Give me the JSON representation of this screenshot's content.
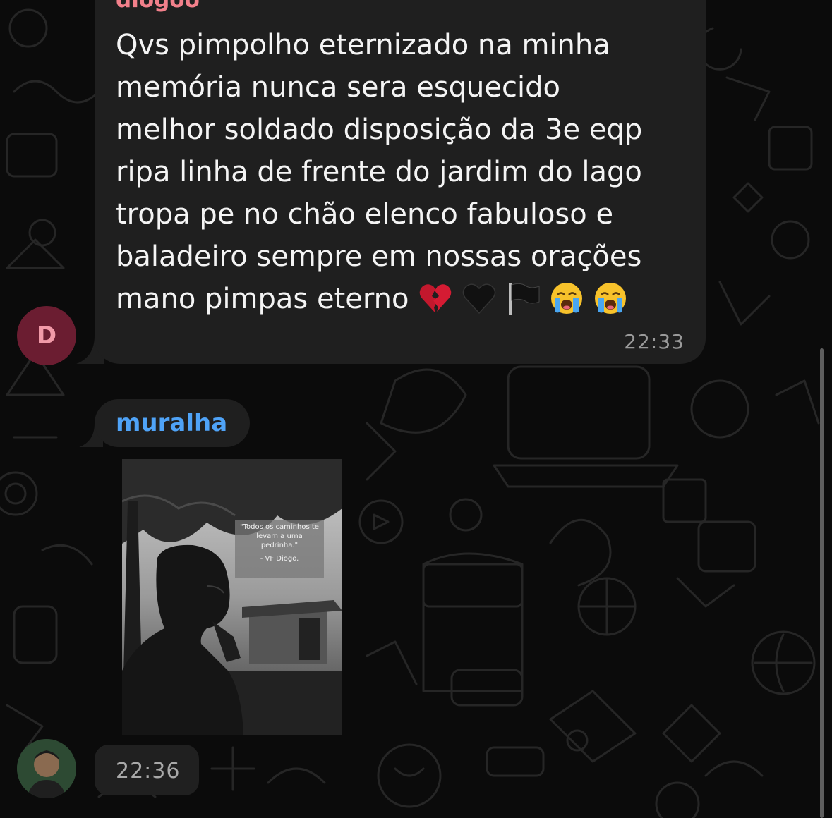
{
  "colors": {
    "background": "#0b0b0b",
    "bubble": "#1f1f1f",
    "sender_1_color": "#f2808b",
    "sender_2_color": "#4fa3f7",
    "avatar_d_bg": "#6b1d31",
    "avatar_d_fg": "#f19aa8",
    "time_color": "#9a9a9a"
  },
  "message_1": {
    "sender": "diogoo",
    "text": "Qvs pimpolho eternizado na minha\nmemória nunca sera esquecido\nmelhor soldado disposição da 3e eqp\nripa linha de frente do jardim do lago\ntropa pe no chão elenco fabuloso e\nbaladeiro sempre em nossas orações\nmano pimpas eterno ",
    "emojis": [
      "broken-heart-emoji",
      "black-heart-emoji",
      "black-flag-emoji",
      "loudly-crying-face-emoji",
      "loudly-crying-face-emoji"
    ],
    "time": "22:33",
    "avatar_initial": "D"
  },
  "message_2": {
    "sender": "muralha",
    "photo_caption": {
      "line1": "\"Todos os caminhos te",
      "line2": "levam a uma",
      "line3": "pedrinha.\"",
      "signature": "- VF Diogo."
    },
    "time": "22:36"
  }
}
